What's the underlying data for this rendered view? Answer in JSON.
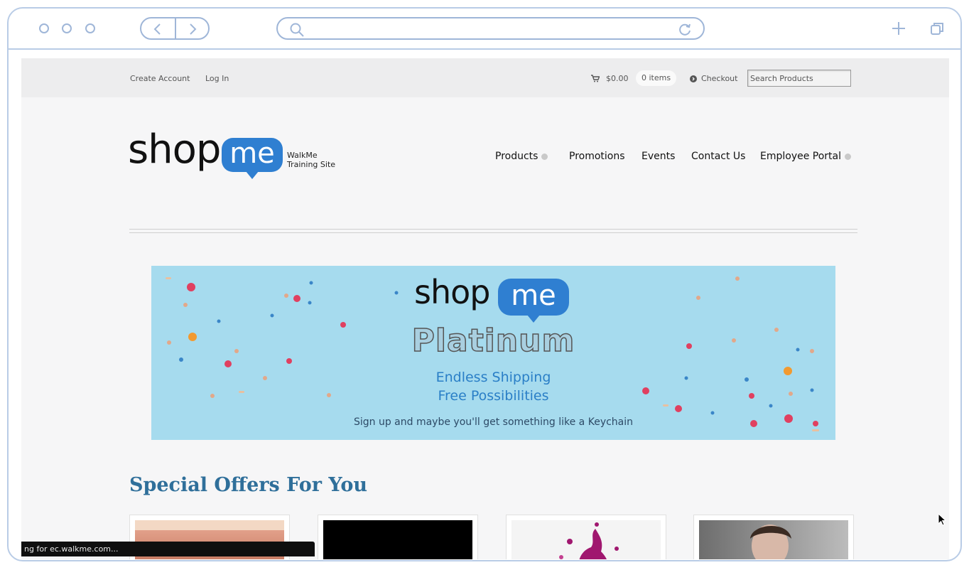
{
  "topbar": {
    "create_account": "Create Account",
    "log_in": "Log In",
    "cart_total": "$0.00",
    "items": "0 items",
    "checkout": "Checkout",
    "search_placeholder": "Search Products"
  },
  "brand": {
    "logo_shop": "shop",
    "logo_me": "me",
    "tagline_line1": "WalkMe",
    "tagline_line2": "Training Site"
  },
  "mainnav": {
    "items": [
      {
        "label": "Products"
      },
      {
        "label": "Promotions"
      },
      {
        "label": "Events"
      },
      {
        "label": "Contact Us"
      },
      {
        "label": "Employee Portal"
      }
    ]
  },
  "banner": {
    "logo_shop": "shop",
    "logo_me": "me",
    "title": "Platinum",
    "line1": "Endless Shipping",
    "line2": "Free Possibilities",
    "subtext": "Sign up and maybe you'll get something like a Keychain"
  },
  "offers": {
    "title": "Special Offers For You"
  },
  "status_bar": {
    "text": "ng for ec.walkme.com..."
  },
  "colors": {
    "brand_blue": "#2f7fd1",
    "banner_bg": "#a6dbee",
    "chrome_outline": "#9fb6d8",
    "heading_blue": "#2f6f9a"
  }
}
